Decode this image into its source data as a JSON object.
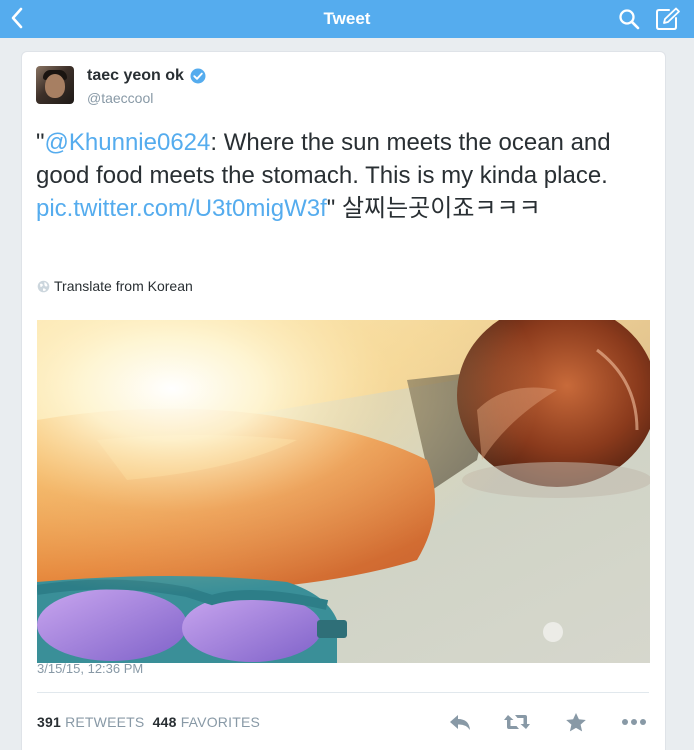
{
  "navbar": {
    "title": "Tweet",
    "background": "#55acee",
    "back_icon": "chevron-left-icon",
    "search_icon": "search-icon",
    "compose_icon": "compose-icon"
  },
  "author": {
    "name": "taec yeon ok",
    "handle": "@taeccool",
    "verified": true
  },
  "tweet": {
    "quote_open": "\"",
    "mention": "@Khunnie0624",
    "text_body": ": Where the sun meets the ocean and good food meets the stomach. This is my kinda place. ",
    "link": "pic.twitter.com/U3t0migW3f",
    "quote_close_and_korean": "\" 살찌는곳이죠ㅋㅋㅋ",
    "link_color": "#55acee"
  },
  "translate": {
    "label": "Translate from Korean",
    "icon": "globe-icon"
  },
  "timestamp": "3/15/15, 12:36 PM",
  "stats": {
    "retweets_count": "391",
    "retweets_label": "RETWEETS",
    "favorites_count": "448",
    "favorites_label": "FAVORITES"
  },
  "actions": {
    "reply_icon": "reply-icon",
    "retweet_icon": "retweet-icon",
    "favorite_icon": "star-icon",
    "more_icon": "more-icon"
  }
}
